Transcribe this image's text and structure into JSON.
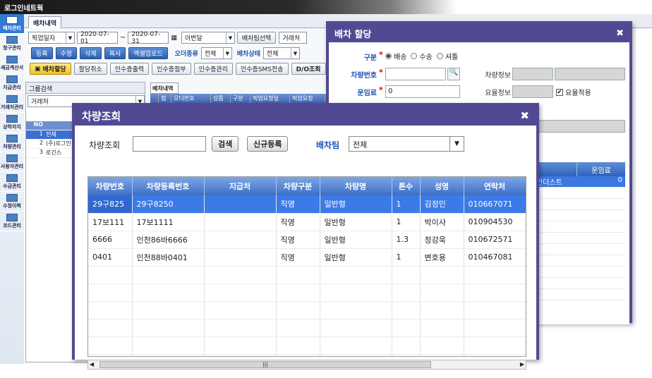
{
  "app": {
    "title": "로그인네트웍"
  },
  "nav": [
    "배차관리",
    "청구관리",
    "세금계산서",
    "지급관리",
    "거래처관리",
    "상하차지",
    "처량관리",
    "사용자관리",
    "수금관리",
    "수정이력",
    "코드관리"
  ],
  "main_tab": "배차내역",
  "toolbar1": {
    "date_type": "픽업일자",
    "date_from": "2020-07-01",
    "sep": "~",
    "date_to": "2020-07-31",
    "week": "이번달",
    "team_btn": "배차팀선택",
    "customer_ph": "거래처"
  },
  "toolbar2": {
    "buttons": [
      "등록",
      "수정",
      "삭제",
      "복사",
      "엑셀업로드"
    ],
    "order_type_label": "오더종류",
    "order_type": "전체",
    "status_label": "배차상태",
    "status": "전체"
  },
  "toolbar3": {
    "assign": "배차할당",
    "cancel": "할당취소",
    "buttons": [
      "인수증출력",
      "인수증첨부",
      "인수증관리",
      "인수증SMS전송"
    ],
    "do": "D/O조회"
  },
  "group": {
    "title": "그룹검색",
    "select": "거래처",
    "col_no": "NO",
    "rows": [
      {
        "no": "1",
        "name": "전체"
      },
      {
        "no": "2",
        "name": "(주)로그인"
      },
      {
        "no": "3",
        "name": "로긴스"
      }
    ]
  },
  "inner": {
    "tab": "배차내역",
    "headers": [
      "",
      "첨",
      "오더번호",
      "상품",
      "구분",
      "픽업요청일",
      "픽업요청"
    ]
  },
  "dialog1": {
    "title": "배차 할당",
    "type_label": "구분",
    "type_options": [
      "배송",
      "수송",
      "셔틀"
    ],
    "vehicle_label": "차량번호",
    "vehicle_info_label": "차량정보",
    "fare_label": "운임료",
    "fare_value": "0",
    "rate_info_label": "요율정보",
    "rate_apply": "요율적용",
    "grid_head": [
      "",
      "운임료"
    ],
    "grid_row": {
      "name": "인더스트",
      "value": "0"
    }
  },
  "dialog2": {
    "title": "차량조회",
    "search_label": "차량조회",
    "search_value": "",
    "search_btn": "검색",
    "new_btn": "신규등록",
    "team_label": "배차팀",
    "team_value": "전체",
    "columns": [
      "차량번호",
      "차량등록번호",
      "지급처",
      "차량구분",
      "차량명",
      "톤수",
      "성명",
      "연락처"
    ],
    "rows": [
      [
        "29구825",
        "29구8250",
        "",
        "직영",
        "일반형",
        "1",
        "김정민",
        "010667071"
      ],
      [
        "17보111",
        "17보1111",
        "",
        "직영",
        "일반형",
        "1",
        "박이사",
        "010904530"
      ],
      [
        "6666",
        "인천86바6666",
        "",
        "직영",
        "일반형",
        "1.3",
        "정강욱",
        "010672571"
      ],
      [
        "0401",
        "인천88바0401",
        "",
        "직영",
        "일반형",
        "1",
        "변호용",
        "010467081"
      ]
    ],
    "scroll_grip": "|||"
  },
  "colors": {
    "dialog_border": "#514a93",
    "header_blue": "#3c6fc6",
    "highlight": "#3b7be8"
  }
}
